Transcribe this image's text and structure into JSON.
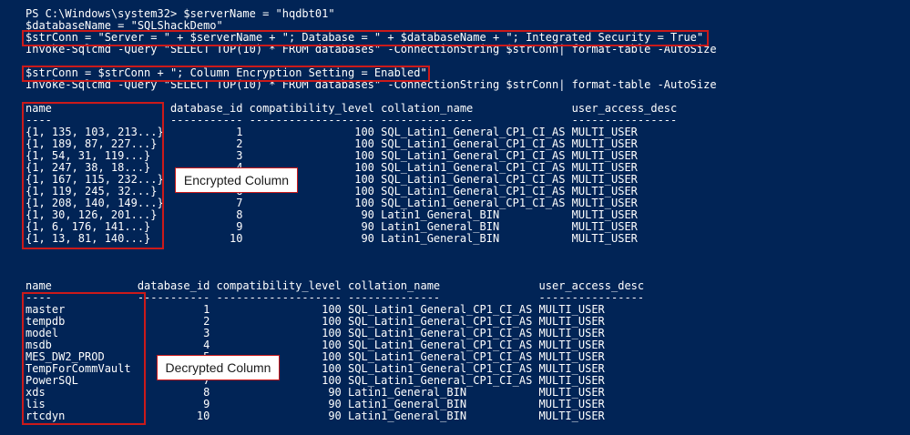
{
  "colors": {
    "background": "#012456",
    "text": "#ffffff",
    "highlight": "#cc1a1a"
  },
  "console": {
    "lines": [
      "PS C:\\Windows\\system32> $serverName = \"hqdbt01\"",
      "$databaseName = \"SQLShackDemo\"",
      "$strConn = \"Server = \" + $serverName + \"; Database = \" + $databaseName + \"; Integrated Security = True\"",
      "Invoke-Sqlcmd -Query \"SELECT TOP(10) * FROM databases\" -ConnectionString $strConn| format-table -AutoSize",
      "",
      "$strConn = $strConn + \"; Column Encryption Setting = Enabled\"",
      "Invoke-Sqlcmd -Query \"SELECT TOP(10) * FROM databases\" -ConnectionString $strConn| format-table -AutoSize",
      "",
      "name                  database_id compatibility_level collation_name               user_access_desc",
      "----                  ----------- ------------------- --------------               ----------------",
      "{1, 135, 103, 213...}           1                 100 SQL_Latin1_General_CP1_CI_AS MULTI_USER",
      "{1, 189, 87, 227...}            2                 100 SQL_Latin1_General_CP1_CI_AS MULTI_USER",
      "{1, 54, 31, 119...}             3                 100 SQL_Latin1_General_CP1_CI_AS MULTI_USER",
      "{1, 247, 38, 18...}             4                 100 SQL_Latin1_General_CP1_CI_AS MULTI_USER",
      "{1, 167, 115, 232...}           5                 100 SQL_Latin1_General_CP1_CI_AS MULTI_USER",
      "{1, 119, 245, 32...}            6                 100 SQL_Latin1_General_CP1_CI_AS MULTI_USER",
      "{1, 208, 140, 149...}           7                 100 SQL_Latin1_General_CP1_CI_AS MULTI_USER",
      "{1, 30, 126, 201...}            8                  90 Latin1_General_BIN           MULTI_USER",
      "{1, 6, 176, 141...}             9                  90 Latin1_General_BIN           MULTI_USER",
      "{1, 13, 81, 140...}            10                  90 Latin1_General_BIN           MULTI_USER",
      "",
      "",
      "",
      "name             database_id compatibility_level collation_name               user_access_desc",
      "----             ----------- ------------------- --------------               ----------------",
      "master                     1                 100 SQL_Latin1_General_CP1_CI_AS MULTI_USER",
      "tempdb                     2                 100 SQL_Latin1_General_CP1_CI_AS MULTI_USER",
      "model                      3                 100 SQL_Latin1_General_CP1_CI_AS MULTI_USER",
      "msdb                       4                 100 SQL_Latin1_General_CP1_CI_AS MULTI_USER",
      "MES_DW2_PROD               5                 100 SQL_Latin1_General_CP1_CI_AS MULTI_USER",
      "TempForCommVault           6                 100 SQL_Latin1_General_CP1_CI_AS MULTI_USER",
      "PowerSQL                   7                 100 SQL_Latin1_General_CP1_CI_AS MULTI_USER",
      "xds                        8                  90 Latin1_General_BIN           MULTI_USER",
      "lis                        9                  90 Latin1_General_BIN           MULTI_USER",
      "rtcdyn                    10                  90 Latin1_General_BIN           MULTI_USER"
    ]
  },
  "annotations": {
    "encrypted_label": "Encrypted Column",
    "decrypted_label": "Decrypted Column"
  }
}
